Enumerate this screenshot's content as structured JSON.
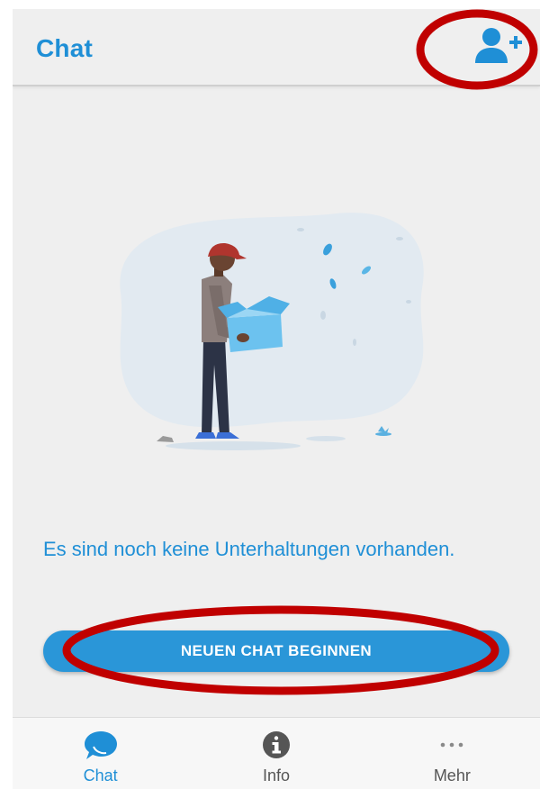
{
  "header": {
    "title": "Chat",
    "add_contact_icon": "add-user-icon"
  },
  "empty_state": {
    "message": "Es sind noch keine Unterhaltungen vorhanden.",
    "button_label": "NEUEN CHAT BEGINNEN"
  },
  "bottom_nav": {
    "items": [
      {
        "label": "Chat",
        "icon": "chat-bubble-icon",
        "active": true
      },
      {
        "label": "Info",
        "icon": "info-icon",
        "active": false
      },
      {
        "label": "Mehr",
        "icon": "more-dots-icon",
        "active": false
      }
    ]
  },
  "colors": {
    "accent": "#1f8fd6",
    "button": "#2a96d8",
    "background": "#efefef",
    "annotation": "#c00000"
  }
}
